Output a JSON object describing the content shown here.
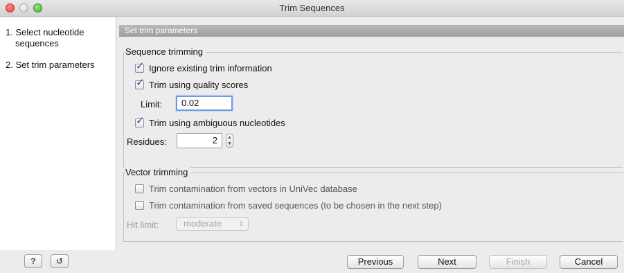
{
  "window": {
    "title": "Trim Sequences"
  },
  "sidebar": {
    "steps": [
      {
        "label": "1. Select nucleotide sequences"
      },
      {
        "label": "2. Set trim parameters"
      }
    ]
  },
  "panel": {
    "header": "Set trim parameters",
    "sequence_trimming": {
      "title": "Sequence trimming",
      "ignore_existing": {
        "label": "Ignore existing trim information",
        "checked": true
      },
      "trim_quality": {
        "label": "Trim using quality scores",
        "checked": true
      },
      "limit_label": "Limit:",
      "limit_value": "0.02",
      "trim_ambiguous": {
        "label": "Trim using ambiguous nucleotides",
        "checked": true
      },
      "residues_label": "Residues:",
      "residues_value": "2"
    },
    "vector_trimming": {
      "title": "Vector trimming",
      "univec": {
        "label": "Trim contamination from vectors in UniVec database",
        "checked": false
      },
      "saved": {
        "label": "Trim contamination from saved sequences (to be chosen in the next step)",
        "checked": false
      },
      "hit_limit_label": "Hit limit:",
      "hit_limit_value": "moderate"
    }
  },
  "footer": {
    "help": "?",
    "previous": "Previous",
    "next": "Next",
    "finish": "Finish",
    "cancel": "Cancel"
  },
  "icons": {
    "check": "✓",
    "stepper_up": "▲",
    "stepper_down": "▼",
    "select_arrows": "⇕",
    "reset": "↺"
  }
}
